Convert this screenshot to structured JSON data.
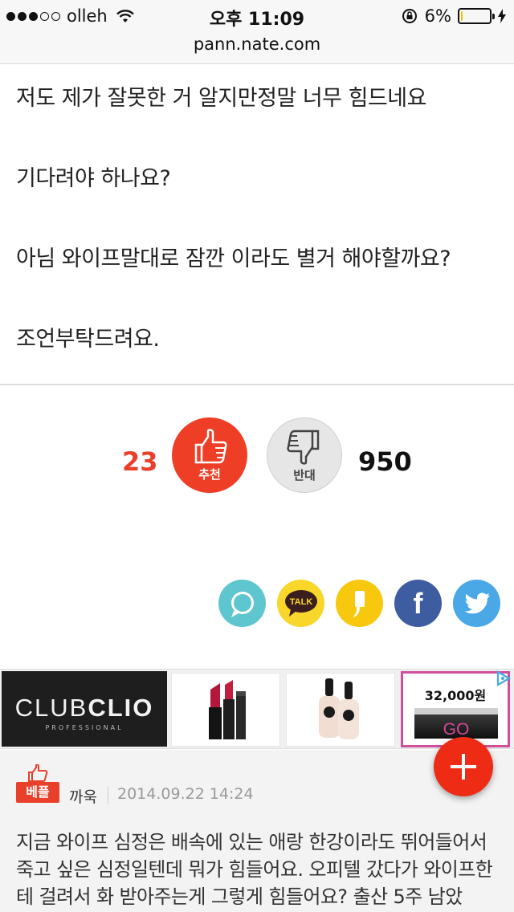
{
  "status_bar": {
    "carrier": "olleh",
    "time": "오후 11:09",
    "battery": "6%",
    "battery_level": 0.06
  },
  "browser": {
    "url": "pann.nate.com"
  },
  "article": {
    "paragraphs": [
      "저도 제가 잘못한 거 알지만정말 너무 힘드네요",
      "기다려야 하나요?",
      "아님 와이프말대로 잠깐 이라도 별거 해야할까요?",
      "조언부탁드려요."
    ]
  },
  "votes": {
    "up_count": "23",
    "up_label": "추천",
    "down_label": "반대",
    "down_count": "950"
  },
  "share": {
    "kakaotalk_label": "TALK",
    "facebook_label": "f"
  },
  "ad": {
    "brand_main": "CLUB",
    "brand_bold": "CLIO",
    "brand_sub": "PROFESSIONAL",
    "price": "32,000원",
    "cta": "GO",
    "accent": "#d04f9c"
  },
  "comment": {
    "badge": "베플",
    "author": "까욱",
    "date": "2014.09.22 14:24",
    "body": "지금 와이프 심정은 배속에 있는 애랑 한강이라도 뛰어들어서 죽고 싶은 심정일텐데 뭐가 힘들어요. 오피텔 갔다가 와이프한테 걸려서 화 받아주는게 그렇게 힘들어요? 출산 5주 남았"
  },
  "colors": {
    "recommend_red": "#ee3e26",
    "count_red": "#e8402a"
  }
}
